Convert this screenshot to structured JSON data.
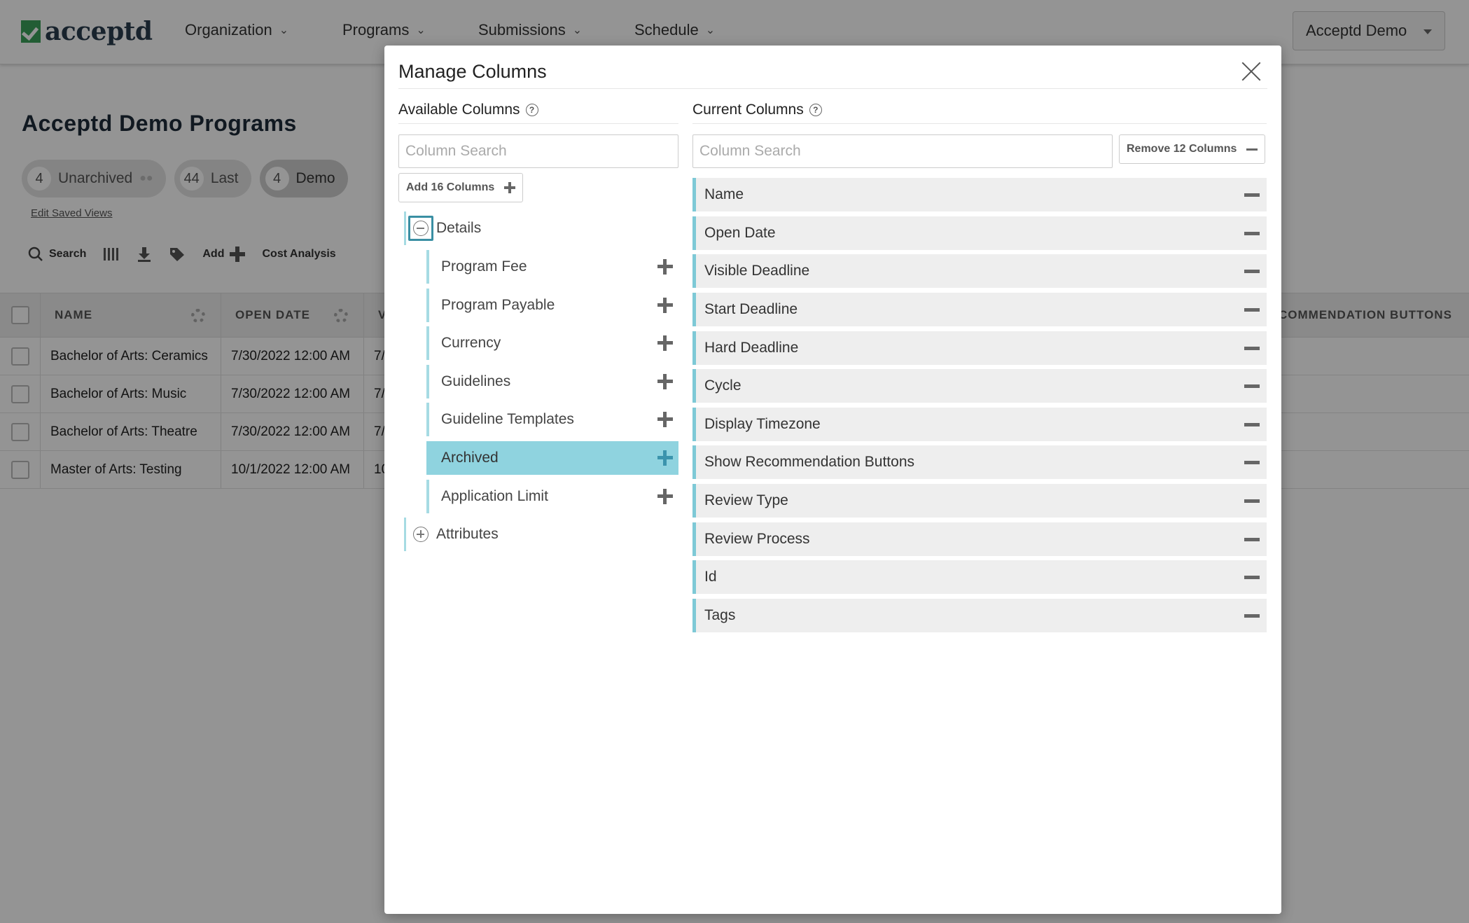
{
  "app": {
    "logo_text": "acceptd",
    "nav": [
      {
        "label": "Organization"
      },
      {
        "label": "Programs"
      },
      {
        "label": "Submissions"
      },
      {
        "label": "Schedule"
      }
    ],
    "account_label": "Acceptd Demo"
  },
  "page": {
    "title": "Acceptd Demo Programs",
    "saved_views": [
      {
        "count": "4",
        "label": "Unarchived"
      },
      {
        "count": "44",
        "label": "Last"
      },
      {
        "count": "4",
        "label": "Demo"
      }
    ],
    "edit_saved_views": "Edit Saved Views",
    "toolbar": {
      "search": "Search",
      "add": "Add",
      "cost_analysis": "Cost Analysis"
    }
  },
  "grid": {
    "headers": [
      "NAME",
      "OPEN DATE",
      "V",
      "COMMENDATION BUTTONS"
    ],
    "rows": [
      {
        "name": "Bachelor of Arts: Ceramics",
        "open_date": "7/30/2022 12:00 AM",
        "v": "7/"
      },
      {
        "name": "Bachelor of Arts: Music",
        "open_date": "7/30/2022 12:00 AM",
        "v": "7/"
      },
      {
        "name": "Bachelor of Arts: Theatre",
        "open_date": "7/30/2022 12:00 AM",
        "v": "7/"
      },
      {
        "name": "Master of Arts: Testing",
        "open_date": "10/1/2022 12:00 AM",
        "v": "10"
      }
    ]
  },
  "modal": {
    "title": "Manage Columns",
    "available": {
      "label": "Available Columns",
      "search_placeholder": "Column Search",
      "add_button": "Add 16 Columns",
      "groups": [
        {
          "label": "Details",
          "expanded": true,
          "items": [
            {
              "label": "Program Fee"
            },
            {
              "label": "Program Payable"
            },
            {
              "label": "Currency"
            },
            {
              "label": "Guidelines"
            },
            {
              "label": "Guideline Templates"
            },
            {
              "label": "Archived",
              "selected": true
            },
            {
              "label": "Application Limit"
            }
          ]
        },
        {
          "label": "Attributes",
          "expanded": false
        }
      ]
    },
    "current": {
      "label": "Current Columns",
      "search_placeholder": "Column Search",
      "remove_button": "Remove 12 Columns",
      "items": [
        {
          "label": "Name"
        },
        {
          "label": "Open Date"
        },
        {
          "label": "Visible Deadline"
        },
        {
          "label": "Start Deadline"
        },
        {
          "label": "Hard Deadline"
        },
        {
          "label": "Cycle"
        },
        {
          "label": "Display Timezone"
        },
        {
          "label": "Show Recommendation Buttons"
        },
        {
          "label": "Review Type"
        },
        {
          "label": "Review Process"
        },
        {
          "label": "Id"
        },
        {
          "label": "Tags"
        }
      ]
    }
  },
  "colors": {
    "accent": "#8fd3df",
    "accent_dark": "#3a8fa3",
    "brand_green": "#3ba15a"
  }
}
